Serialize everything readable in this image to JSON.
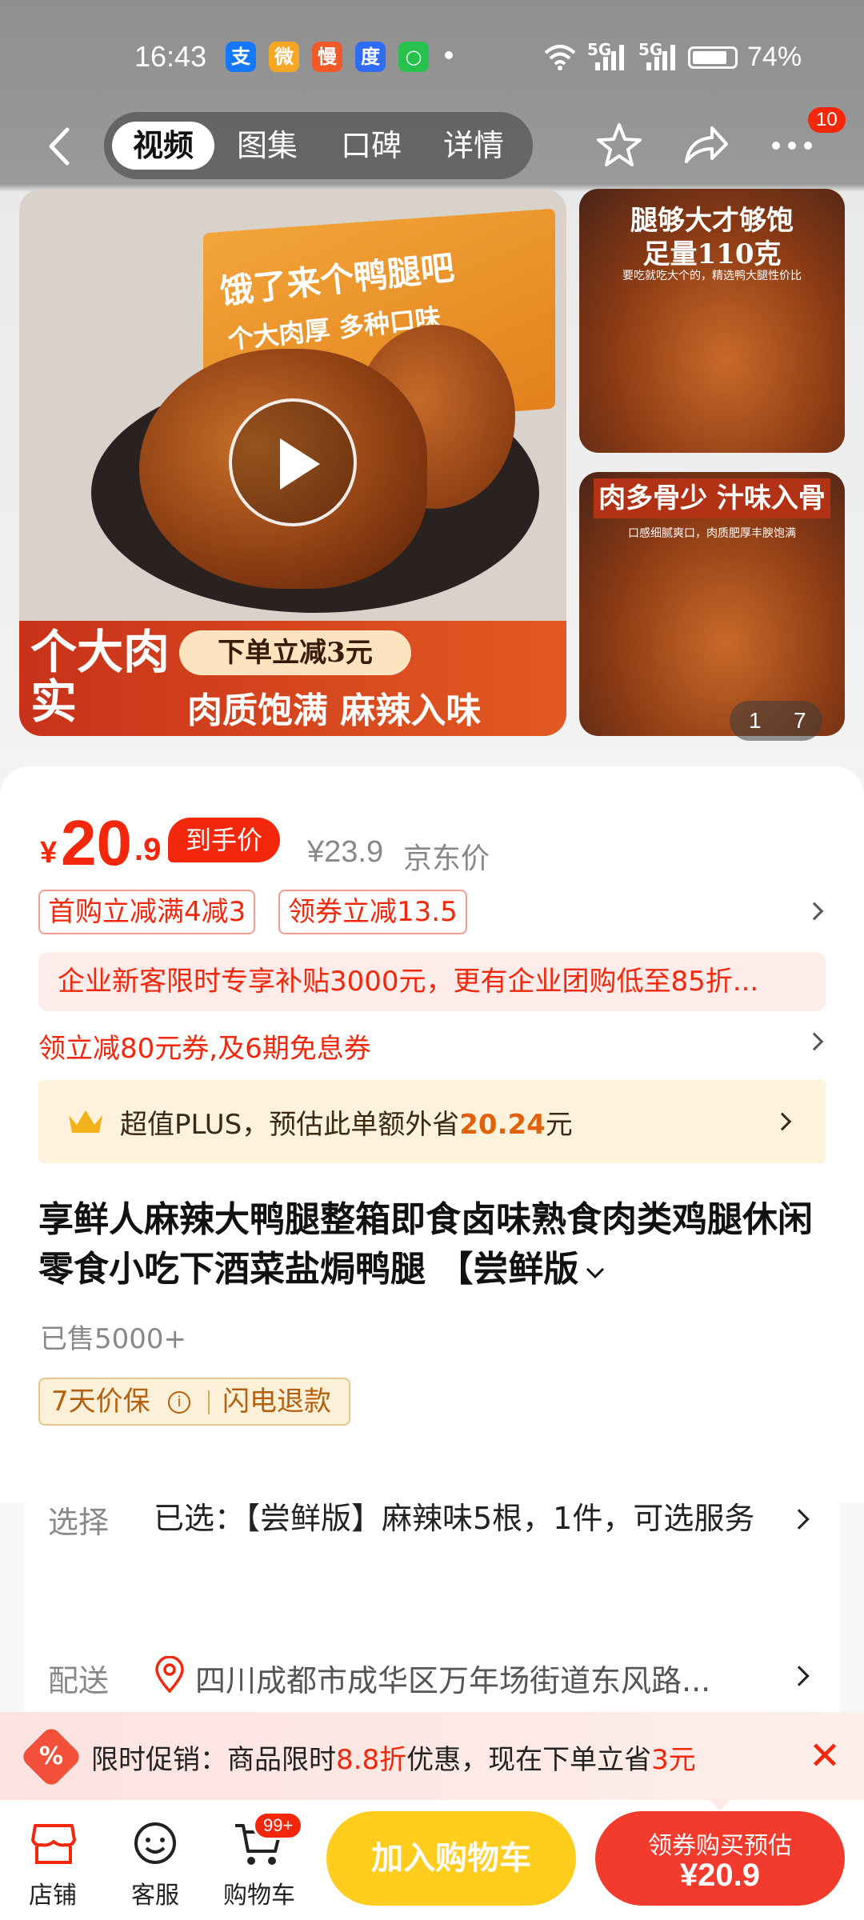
{
  "status_bar": {
    "time": "16:43",
    "apps": [
      {
        "icon": "alipay-icon",
        "glyph": "支",
        "color": "#1677ff"
      },
      {
        "icon": "weibo-icon",
        "glyph": "微",
        "color": "#f5a623"
      },
      {
        "icon": "app-icon",
        "glyph": "慢",
        "color": "#f05a28"
      },
      {
        "icon": "baidu-icon",
        "glyph": "度",
        "color": "#2f6cf6"
      },
      {
        "icon": "chat-icon",
        "glyph": "○",
        "color": "#27c24c"
      }
    ],
    "network_1": "5G",
    "network_2": "5G",
    "battery": "74%"
  },
  "header": {
    "tabs": [
      {
        "label": "视频",
        "active": true
      },
      {
        "label": "图集",
        "active": false
      },
      {
        "label": "口碑",
        "active": false
      },
      {
        "label": "详情",
        "active": false
      }
    ],
    "more_badge": "10"
  },
  "gallery": {
    "main": {
      "box_title": "饿了来个鸭腿吧",
      "box_subtitle": "个大肉厚 多种口味",
      "banner_big": "个大肉实",
      "banner_pill": "下单立减3元",
      "banner_slogan": "肉质饱满 麻辣入味"
    },
    "thumb_1": {
      "line1": "腿够大才够饱",
      "line2": "足量110克",
      "line3": "要吃就吃大个的，精选鸭大腿性价比"
    },
    "thumb_2": {
      "caption": "肉多骨少 汁味入骨",
      "sub": "口感细腻爽口，肉质肥厚丰腴饱满"
    },
    "counter_current": "1",
    "counter_total": "7"
  },
  "price": {
    "symbol": "¥",
    "integer": "20",
    "decimal": ".9",
    "arrive_label": "到手价",
    "original": "¥23.9",
    "original_label": "京东价"
  },
  "coupons": [
    "首购立减满4减3",
    "领券立减13.5"
  ],
  "notice": "企业新客限时专享补贴3000元，更有企业团购低至85折...",
  "promo_line": "领立减80元券,及6期免息券",
  "plus": {
    "prefix": "超值PLUS，预估此单额外省",
    "amount": "20.24",
    "suffix": "元"
  },
  "product": {
    "title": "享鲜人麻辣大鸭腿整箱即食卤味熟食肉类鸡腿休闲零食小吃下酒菜盐焗鸭腿 【尝鲜版",
    "sold": "已售5000+",
    "guarantee_1": "7天价保",
    "guarantee_2": "闪电退款"
  },
  "spec": {
    "select_label": "选择",
    "select_value": "已选：【尝鲜版】麻辣味5根，1件，可选服务",
    "delivery_label": "配送",
    "delivery_value": "四川成都市成华区万年场街道东风路..."
  },
  "flash_promo": {
    "prefix": "限时促销：商品限时",
    "discount": "8.8折",
    "middle": "优惠，现在下单立省",
    "save": "3元"
  },
  "bottom_bar": {
    "store": "店铺",
    "service": "客服",
    "cart": "购物车",
    "cart_badge": "99+",
    "add_cart": "加入购物车",
    "buy_line1": "领券购买预估",
    "buy_line2": "¥20.9"
  }
}
